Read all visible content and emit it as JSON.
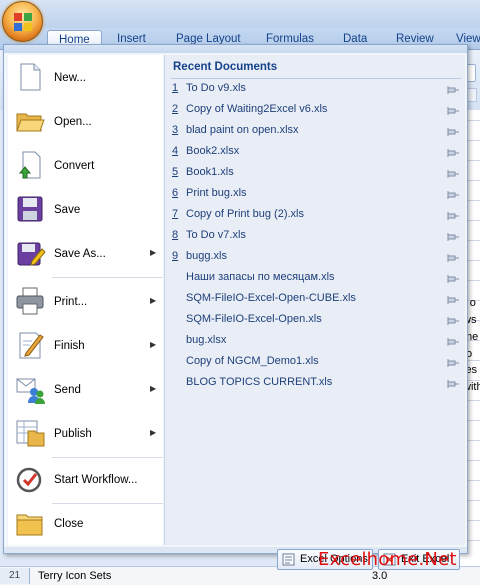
{
  "ribbon": {
    "tabs": [
      "Home",
      "Insert",
      "Page Layout",
      "Formulas",
      "Data",
      "Review",
      "View"
    ],
    "active_tab": "Home"
  },
  "sheet_fragments": [
    ") o",
    "ws",
    "me",
    " fo",
    "les",
    "with"
  ],
  "status": {
    "row_number": "21",
    "row_text": "Terry Icon Sets",
    "row_value": "3.0"
  },
  "office_menu": {
    "items": [
      {
        "label": "New...",
        "icon": "new-document-icon",
        "submenu": false
      },
      {
        "label": "Open...",
        "icon": "open-folder-icon",
        "submenu": false
      },
      {
        "label": "Convert",
        "icon": "convert-icon",
        "submenu": false
      },
      {
        "label": "Save",
        "icon": "save-disk-icon",
        "submenu": false
      },
      {
        "label": "Save As...",
        "icon": "save-as-icon",
        "submenu": true
      },
      {
        "label": "Print...",
        "icon": "printer-icon",
        "submenu": true
      },
      {
        "label": "Finish",
        "icon": "finish-document-icon",
        "submenu": true
      },
      {
        "label": "Send",
        "icon": "send-people-icon",
        "submenu": true
      },
      {
        "label": "Publish",
        "icon": "publish-icon",
        "submenu": true
      },
      {
        "label": "Start Workflow...",
        "icon": "workflow-icon",
        "submenu": false
      },
      {
        "label": "Close",
        "icon": "close-folder-icon",
        "submenu": false
      }
    ],
    "recent": {
      "title": "Recent Documents",
      "documents": [
        {
          "num": "1",
          "name": "To Do v9.xls"
        },
        {
          "num": "2",
          "name": "Copy of Waiting2Excel v6.xls"
        },
        {
          "num": "3",
          "name": "blad paint on open.xlsx"
        },
        {
          "num": "4",
          "name": "Book2.xlsx"
        },
        {
          "num": "5",
          "name": "Book1.xls"
        },
        {
          "num": "6",
          "name": "Print bug.xls"
        },
        {
          "num": "7",
          "name": "Copy of Print bug (2).xls"
        },
        {
          "num": "8",
          "name": "To Do v7.xls"
        },
        {
          "num": "9",
          "name": "bugg.xls"
        },
        {
          "num": "",
          "name": "Наши запасы по месяцам.xls"
        },
        {
          "num": "",
          "name": "SQM-FileIO-Excel-Open-CUBE.xls"
        },
        {
          "num": "",
          "name": "SQM-FileIO-Excel-Open.xls"
        },
        {
          "num": "",
          "name": "bug.xlsx"
        },
        {
          "num": "",
          "name": "Copy of NGCM_Demo1.xls"
        },
        {
          "num": "",
          "name": "BLOG TOPICS CURRENT.xls"
        }
      ]
    },
    "options_button": "Excel Options",
    "exit_button": "Exit Excel"
  },
  "watermark": "Excelhome.Net",
  "colors": {
    "accent": "#15428b",
    "office_button": "#f7b34a",
    "watermark": "#e01010"
  }
}
